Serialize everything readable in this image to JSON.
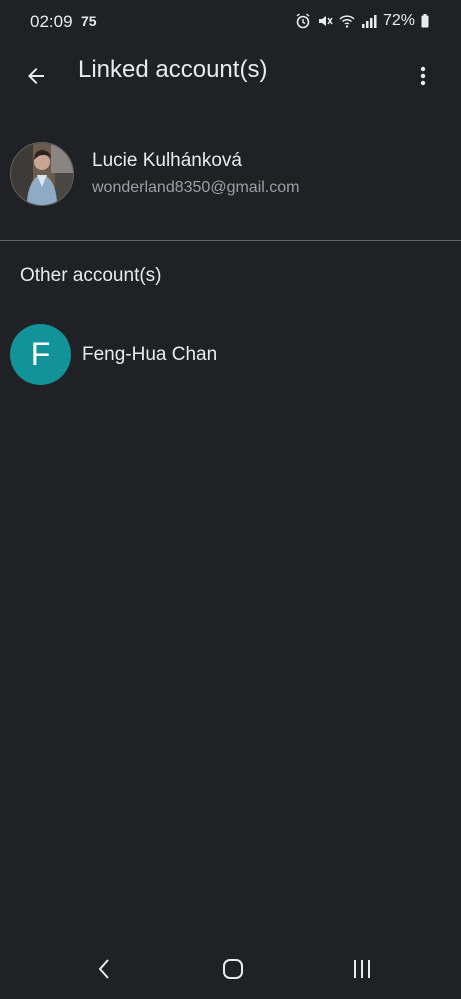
{
  "status_bar": {
    "time": "02:09",
    "extra": "75",
    "battery": "72%",
    "icons": [
      "alarm-icon",
      "mute-icon",
      "wifi-icon",
      "signal-icon",
      "battery-icon"
    ]
  },
  "app_bar": {
    "title": "Linked account(s)",
    "back_icon": "arrow-back-icon",
    "menu_icon": "more-vert-icon"
  },
  "primary_account": {
    "name": "Lucie Kulhánková",
    "email": "wonderland8350@gmail.com"
  },
  "other_section": {
    "header": "Other account(s)",
    "accounts": [
      {
        "initial": "F",
        "name": "Feng-Hua Chan",
        "avatar_color": "#12939a"
      }
    ]
  },
  "nav_bar": {
    "icons": [
      "nav-back-icon",
      "nav-home-icon",
      "nav-recents-icon"
    ]
  },
  "colors": {
    "background": "#202124",
    "text_primary": "#e8eaed",
    "text_secondary": "#9aa0a6",
    "divider": "#5f6368"
  }
}
